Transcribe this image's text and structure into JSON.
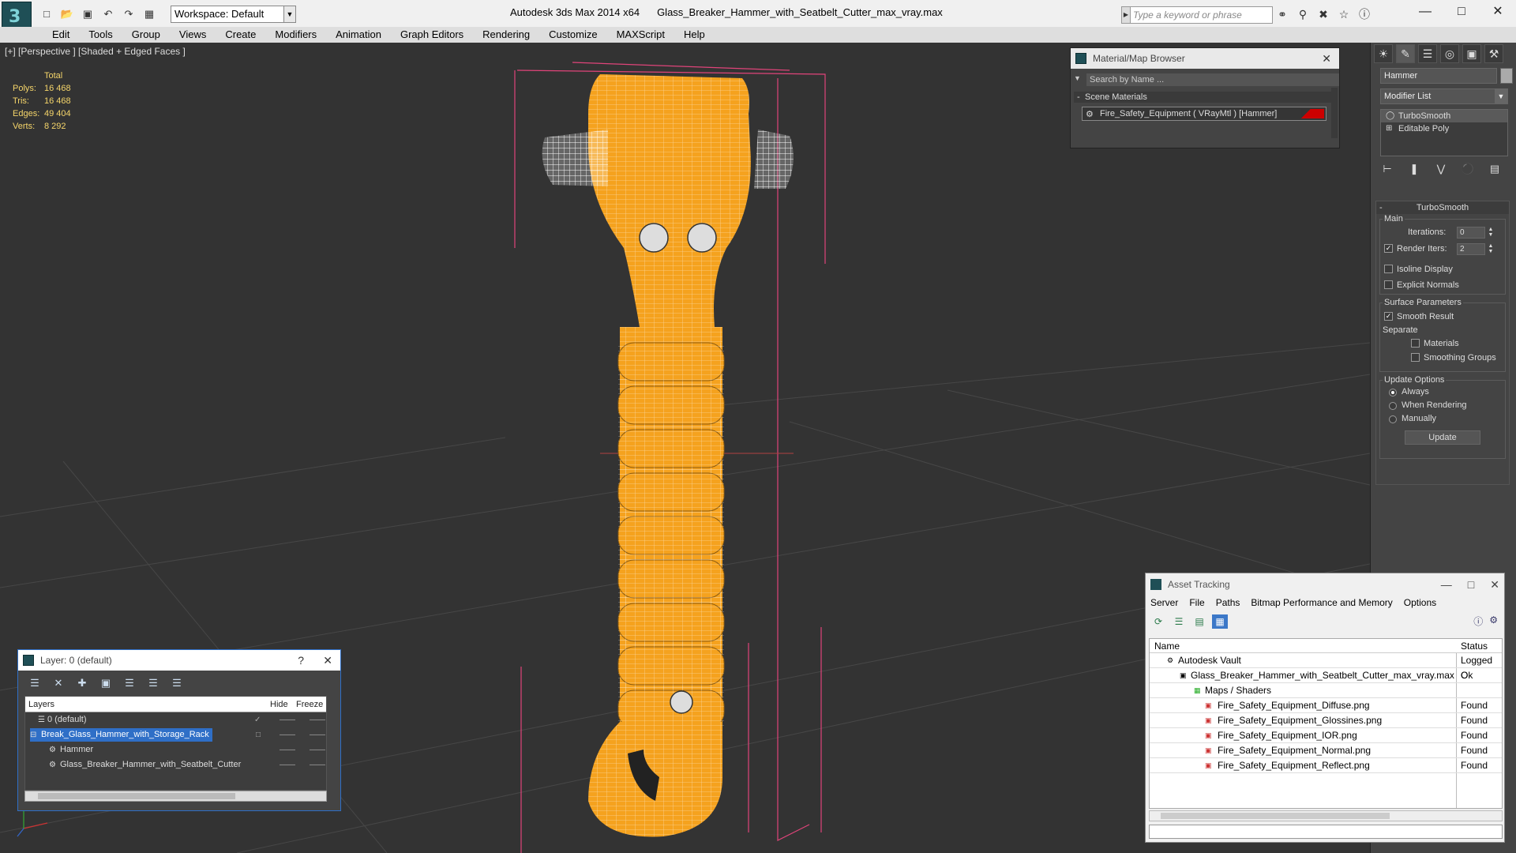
{
  "app": {
    "name": "Autodesk 3ds Max  2014 x64",
    "file": "Glass_Breaker_Hammer_with_Seatbelt_Cutter_max_vray.max",
    "workspace": "Workspace: Default",
    "search_placeholder": "Type a keyword or phrase"
  },
  "menu": [
    "Edit",
    "Tools",
    "Group",
    "Views",
    "Create",
    "Modifiers",
    "Animation",
    "Graph Editors",
    "Rendering",
    "Customize",
    "MAXScript",
    "Help"
  ],
  "viewport": {
    "label": "[+] [Perspective ] [Shaded + Edged Faces ]",
    "stats": {
      "header": "Total",
      "rows": [
        {
          "k": "Polys:",
          "v": "16 468"
        },
        {
          "k": "Tris:",
          "v": "16 468"
        },
        {
          "k": "Edges:",
          "v": "49 404"
        },
        {
          "k": "Verts:",
          "v": "8 292"
        }
      ]
    },
    "colors": {
      "model": "#f5a21e",
      "wire": "#ffffff",
      "bbox": "#e0447a",
      "grid": "#4a4a4a",
      "bg": "#333333"
    }
  },
  "material_browser": {
    "title": "Material/Map Browser",
    "search": "Search by Name ...",
    "section": "Scene Materials",
    "item": "Fire_Safety_Equipment  ( VRayMtl )  [Hammer]"
  },
  "layer_dialog": {
    "title": "Layer: 0 (default)",
    "help": "?",
    "columns": {
      "layers": "Layers",
      "hide": "Hide",
      "freeze": "Freeze"
    },
    "rows": [
      {
        "name": "0 (default)"
      },
      {
        "name": "Break_Glass_Hammer_with_Storage_Rack"
      },
      {
        "name": "Hammer"
      },
      {
        "name": "Glass_Breaker_Hammer_with_Seatbelt_Cutter"
      }
    ]
  },
  "command_panel": {
    "object_name": "Hammer",
    "modifier_list": "Modifier List",
    "stack": [
      "TurboSmooth",
      "Editable Poly"
    ],
    "rollout": {
      "title": "TurboSmooth",
      "main": "Main",
      "iterations_label": "Iterations:",
      "iterations": "0",
      "render_iters_label": "Render Iters:",
      "render_iters": "2",
      "isoline": "Isoline Display",
      "explicit": "Explicit Normals",
      "surface": "Surface Parameters",
      "smooth_result": "Smooth Result",
      "separate": "Separate",
      "materials": "Materials",
      "smoothing_groups": "Smoothing Groups",
      "update_options": "Update Options",
      "always": "Always",
      "when_rendering": "When Rendering",
      "manually": "Manually",
      "update_btn": "Update"
    }
  },
  "asset_tracking": {
    "title": "Asset Tracking",
    "menu": [
      "Server",
      "File",
      "Paths",
      "Bitmap Performance and Memory",
      "Options"
    ],
    "columns": {
      "name": "Name",
      "status": "Status"
    },
    "rows": [
      {
        "name": "Autodesk Vault",
        "status": "Logged O"
      },
      {
        "name": "Glass_Breaker_Hammer_with_Seatbelt_Cutter_max_vray.max",
        "status": "Ok"
      },
      {
        "name": "Maps / Shaders",
        "status": ""
      },
      {
        "name": "Fire_Safety_Equipment_Diffuse.png",
        "status": "Found"
      },
      {
        "name": "Fire_Safety_Equipment_Glossines.png",
        "status": "Found"
      },
      {
        "name": "Fire_Safety_Equipment_IOR.png",
        "status": "Found"
      },
      {
        "name": "Fire_Safety_Equipment_Normal.png",
        "status": "Found"
      },
      {
        "name": "Fire_Safety_Equipment_Reflect.png",
        "status": "Found"
      }
    ]
  }
}
